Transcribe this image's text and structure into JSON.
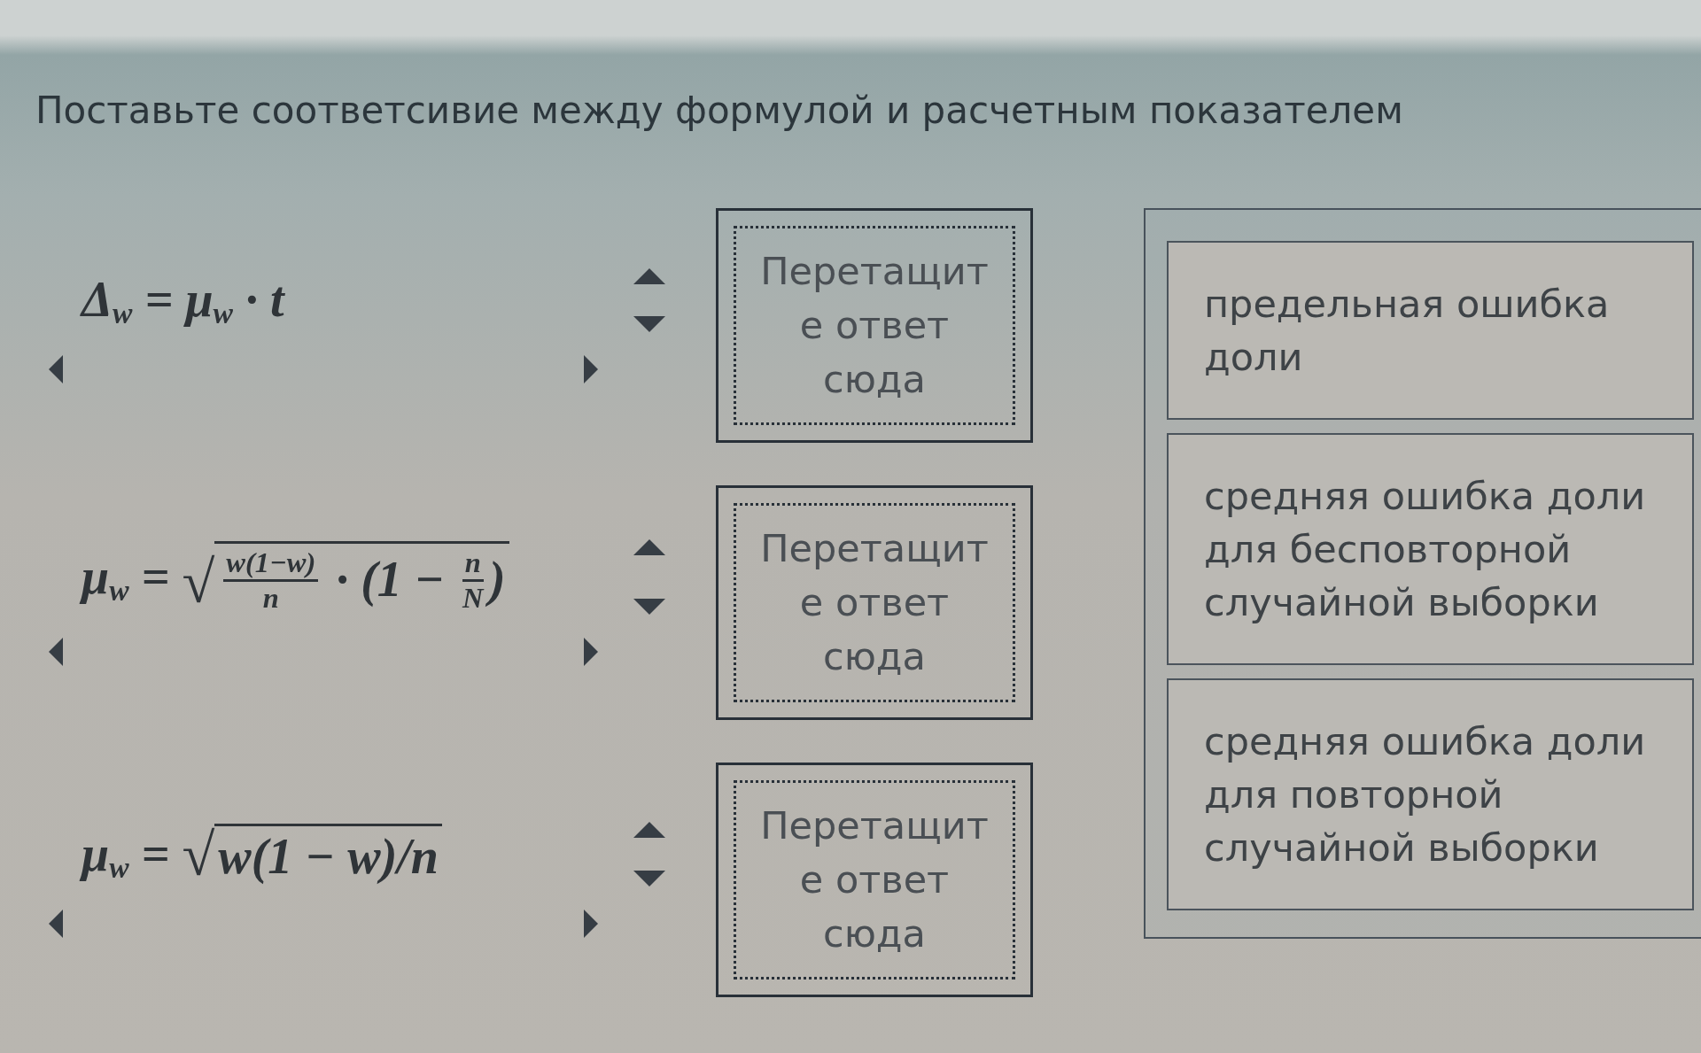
{
  "question": {
    "prompt": "Поставьте соответсивие между формулой и расчетным показателем"
  },
  "matches": [
    {
      "formula": [
        {
          "kind": "text",
          "text": "Δ$_{w}$ = μ$_{w}$ · t"
        }
      ],
      "drop_zone": {
        "placeholder": "Перетащите ответ сюда"
      }
    },
    {
      "formula": [
        {
          "kind": "text",
          "text": "μ$_{w}$ = "
        },
        {
          "kind": "root",
          "sign": "√",
          "body": [
            {
              "kind": "frac",
              "num": "w(1−w)",
              "den": "n"
            },
            {
              "kind": "text",
              "text": " · (1 − "
            },
            {
              "kind": "frac",
              "num": "n",
              "den": "N"
            },
            {
              "kind": "text",
              "text": ")"
            }
          ]
        }
      ],
      "drop_zone": {
        "placeholder": "Перетащите ответ сюда"
      }
    },
    {
      "formula": [
        {
          "kind": "text",
          "text": "μ$_{w}$ = "
        },
        {
          "kind": "root",
          "sign": "√",
          "body": [
            {
              "kind": "text",
              "text": "w(1 − w)/n"
            }
          ]
        }
      ],
      "drop_zone": {
        "placeholder": "Перетащите ответ сюда"
      }
    }
  ],
  "answers": [
    {
      "text": "предельная ошибка доли"
    },
    {
      "text": "средняя ошибка доли для бесповторной случайной выборки"
    },
    {
      "text": "средняя ошибка доли для повторной случайной выборки"
    }
  ]
}
